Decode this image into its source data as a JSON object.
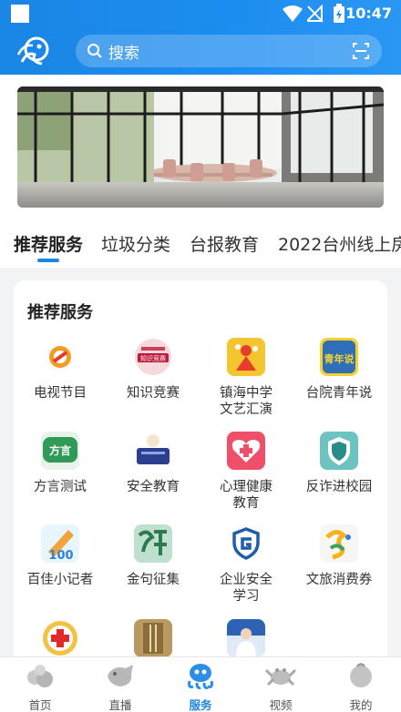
{
  "status_bar": {
    "time": "10:47"
  },
  "header": {
    "search_placeholder": "搜索"
  },
  "tabs": [
    {
      "label": "推荐服务",
      "active": true
    },
    {
      "label": "垃圾分类"
    },
    {
      "label": "台报教育"
    },
    {
      "label": "2022台州线上房"
    }
  ],
  "section": {
    "title": "推荐服务"
  },
  "services": [
    {
      "label": "电视节目",
      "icon": "tv-program-icon"
    },
    {
      "label": "知识竞赛",
      "icon": "quiz-icon",
      "badge_text": "知识竞赛"
    },
    {
      "label": "镇海中学文艺汇演",
      "icon": "performance-icon"
    },
    {
      "label": "台院青年说",
      "icon": "youth-talk-icon",
      "badge_text": "青年说"
    },
    {
      "label": "方言测试",
      "icon": "dialect-icon",
      "badge_text": "方言"
    },
    {
      "label": "安全教育",
      "icon": "safety-education-icon"
    },
    {
      "label": "心理健康教育",
      "icon": "mental-health-icon"
    },
    {
      "label": "反诈进校园",
      "icon": "anti-fraud-icon"
    },
    {
      "label": "百佳小记者",
      "icon": "reporter-icon",
      "badge_text": "100"
    },
    {
      "label": "金句征集",
      "icon": "quote-icon"
    },
    {
      "label": "企业安全学习",
      "icon": "enterprise-safety-icon"
    },
    {
      "label": "文旅消费券",
      "icon": "coupon-icon"
    },
    {
      "label": "",
      "icon": "red-cross-icon"
    },
    {
      "label": "",
      "icon": "vs-icon"
    },
    {
      "label": "",
      "icon": "doctor-icon"
    }
  ],
  "bottom_nav": [
    {
      "label": "首页",
      "icon": "home-icon"
    },
    {
      "label": "直播",
      "icon": "live-icon"
    },
    {
      "label": "服务",
      "icon": "service-icon",
      "active": true
    },
    {
      "label": "视频",
      "icon": "video-icon"
    },
    {
      "label": "我的",
      "icon": "profile-icon"
    }
  ],
  "colors": {
    "primary": "#1a86e6",
    "background": "#f2f3f5"
  }
}
